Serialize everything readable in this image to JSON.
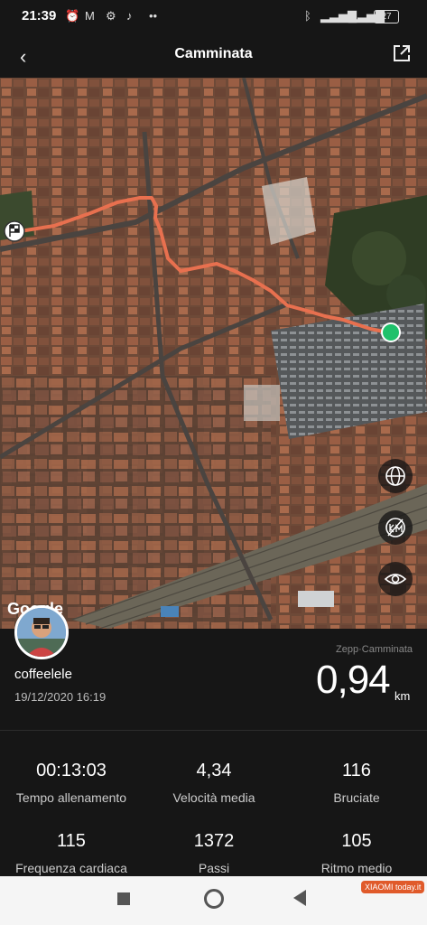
{
  "status": {
    "time": "21:39",
    "battery": "27"
  },
  "header": {
    "title": "Camminata"
  },
  "map": {
    "attribution": "Google"
  },
  "summary": {
    "user": "coffeelele",
    "date": "19/12/2020 16:19",
    "source": "Zepp·Camminata",
    "distance": "0,94",
    "distance_unit": "km"
  },
  "stats": [
    {
      "value": "00:13:03",
      "label": "Tempo allenamento"
    },
    {
      "value": "4,34",
      "label": "Velocità media"
    },
    {
      "value": "116",
      "label": "Bruciate"
    },
    {
      "value": "115",
      "label": "Frequenza cardiaca"
    },
    {
      "value": "1372",
      "label": "Passi"
    },
    {
      "value": "105",
      "label": "Ritmo medio"
    }
  ],
  "watermark": "XIAOMI today.it",
  "colors": {
    "route": "#e8704f",
    "end_marker": "#1fc16b",
    "background": "#161616"
  }
}
